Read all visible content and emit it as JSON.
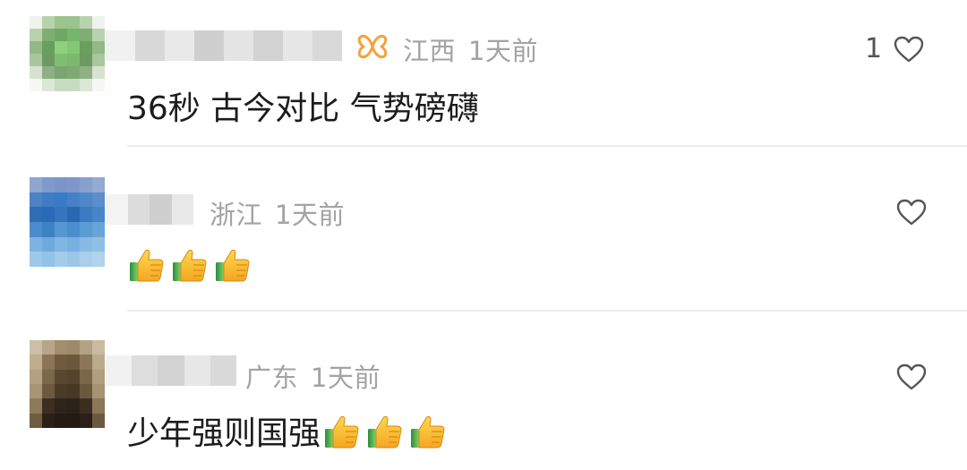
{
  "comments": [
    {
      "location": "江西",
      "time": "1天前",
      "text": "36秒 古今对比 气势磅礴",
      "like_count": "1",
      "has_badge": true,
      "emoji": [],
      "avatar_icon": "blurred-avatar",
      "name_icon": "blurred-username"
    },
    {
      "location": "浙江",
      "time": "1天前",
      "text": "",
      "like_count": "",
      "has_badge": false,
      "emoji": [
        "thumbs-up",
        "thumbs-up",
        "thumbs-up"
      ],
      "avatar_icon": "blurred-avatar",
      "name_icon": "blurred-username"
    },
    {
      "location": "广东",
      "time": "1天前",
      "text": "少年强则国强",
      "like_count": "",
      "has_badge": false,
      "emoji": [
        "thumbs-up",
        "thumbs-up",
        "thumbs-up"
      ],
      "avatar_icon": "blurred-avatar",
      "name_icon": "blurred-username"
    }
  ],
  "icons": {
    "badge": "butterfly-badge-icon",
    "like": "heart-outline-icon",
    "emoji": "thumbs-up-emoji-icon"
  },
  "colors": {
    "meta_text": "#a3a3a3",
    "content_text": "#1c1c1c",
    "badge_orange": "#f3a33b",
    "heart_stroke": "#555555",
    "divider": "#ececec"
  }
}
